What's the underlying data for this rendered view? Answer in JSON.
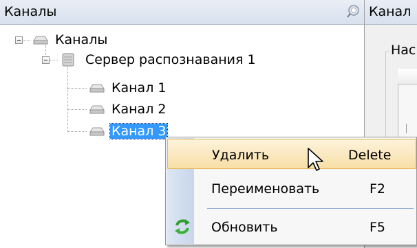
{
  "left_panel": {
    "title": "Каналы",
    "pin_icon": "pin-icon"
  },
  "tree": {
    "root": {
      "label": "Каналы",
      "icon": "channels-icon",
      "expanded": true
    },
    "server": {
      "label": "Сервер распознавания 1",
      "icon": "server-icon",
      "expanded": true
    },
    "channels": [
      {
        "label": "Канал 1",
        "icon": "channel-icon",
        "selected": false
      },
      {
        "label": "Канал 2",
        "icon": "channel-icon",
        "selected": false
      },
      {
        "label": "Канал 3",
        "icon": "channel-icon",
        "selected": true
      }
    ]
  },
  "right_panel": {
    "title": "Канал",
    "group_title": "Нас"
  },
  "context_menu": {
    "items": [
      {
        "label": "Удалить",
        "shortcut": "Delete",
        "highlighted": true,
        "icon": ""
      },
      {
        "label": "Переименовать",
        "shortcut": "F2",
        "highlighted": false,
        "icon": ""
      },
      {
        "label": "Обновить",
        "shortcut": "F5",
        "highlighted": false,
        "icon": "refresh-icon"
      }
    ]
  },
  "colors": {
    "selection": "#3399ff",
    "menu_highlight": "#f8dfa6",
    "header": "#d8e1ee"
  }
}
